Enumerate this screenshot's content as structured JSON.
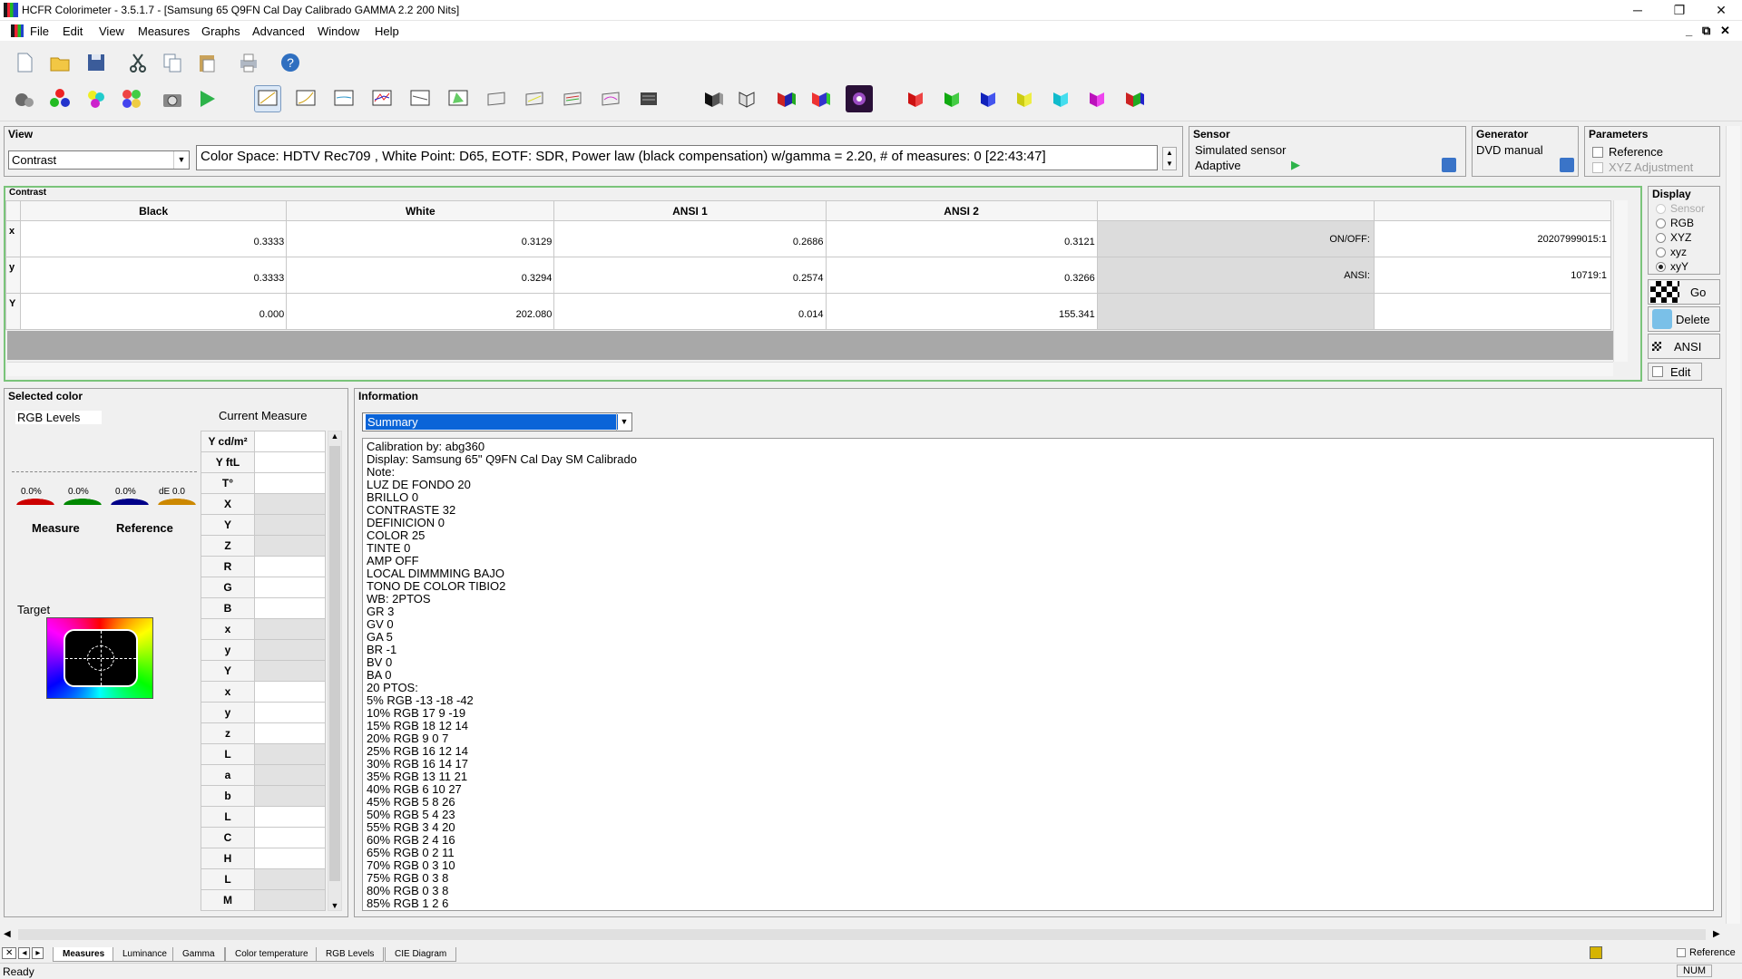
{
  "window": {
    "title": "HCFR Colorimeter - 3.5.1.7 - [Samsung 65 Q9FN Cal Day Calibrado GAMMA 2.2 200 Nits]"
  },
  "menu": [
    "File",
    "Edit",
    "View",
    "Measures",
    "Graphs",
    "Advanced",
    "Window",
    "Help"
  ],
  "view": {
    "header": "View",
    "selected": "Contrast",
    "info": "Color Space: HDTV Rec709 , White Point: D65, EOTF:  SDR, Power law (black compensation) w/gamma = 2.20, # of measures: 0 [22:43:47]"
  },
  "sensor": {
    "header": "Sensor",
    "name": "Simulated sensor",
    "mode": "Adaptive"
  },
  "generator": {
    "header": "Generator",
    "name": "DVD manual"
  },
  "parameters": {
    "header": "Parameters",
    "reference": "Reference",
    "xyz_adjustment": "XYZ Adjustment"
  },
  "contrast": {
    "title": "Contrast",
    "columns": [
      "Black",
      "White",
      "ANSI 1",
      "ANSI 2",
      "",
      ""
    ],
    "rows": [
      {
        "label": "x",
        "values": [
          "0.3333",
          "0.3129",
          "0.2686",
          "0.3121"
        ],
        "metric_label": "ON/OFF:",
        "metric_value": "20207999015:1"
      },
      {
        "label": "y",
        "values": [
          "0.3333",
          "0.3294",
          "0.2574",
          "0.3266"
        ],
        "metric_label": "ANSI:",
        "metric_value": "10719:1"
      },
      {
        "label": "Y",
        "values": [
          "0.000",
          "202.080",
          "0.014",
          "155.341"
        ],
        "metric_label": "",
        "metric_value": ""
      }
    ]
  },
  "display": {
    "header": "Display",
    "options": [
      "Sensor",
      "RGB",
      "XYZ",
      "xyz",
      "xyY"
    ],
    "selected": "xyY"
  },
  "side_buttons": {
    "go": "Go",
    "delete": "Delete",
    "ansi": "ANSI",
    "edit": "Edit"
  },
  "selected_color": {
    "header": "Selected color",
    "rgb_levels": "RGB Levels",
    "current_measure": "Current Measure",
    "bars": [
      "0.0%",
      "0.0%",
      "0.0%",
      "dE 0.0"
    ],
    "measure": "Measure",
    "reference": "Reference",
    "target": "Target",
    "row_labels": [
      "Y cd/m²",
      "Y ftL",
      "T°",
      "X",
      "Y",
      "Z",
      "R",
      "G",
      "B",
      "x",
      "y",
      "Y",
      "x",
      "y",
      "z",
      "L",
      "a",
      "b",
      "L",
      "C",
      "H",
      "L",
      "M"
    ]
  },
  "information": {
    "header": "Information",
    "selected": "Summary",
    "lines": [
      "Calibration by: abg360",
      "Display: Samsung 65\" Q9FN Cal Day SM Calibrado",
      "Note:",
      "LUZ DE FONDO 20",
      "BRILLO 0",
      "CONTRASTE 32",
      "DEFINICION 0",
      "COLOR 25",
      "TINTE 0",
      "AMP OFF",
      "LOCAL DIMMMING BAJO",
      "TONO DE COLOR TIBIO2",
      "WB: 2PTOS",
      "GR 3",
      "GV 0",
      "GA 5",
      "BR -1",
      "BV 0",
      "BA 0",
      "20 PTOS:",
      "5% RGB -13 -18 -42",
      "10% RGB 17 9 -19",
      "15% RGB 18 12 14",
      "20% RGB 9 0 7",
      "25% RGB 16 12 14",
      "30% RGB 16 14 17",
      "35% RGB 13 11 21",
      "40% RGB 6 10 27",
      "45% RGB 5 8 26",
      "50% RGB 5 4 23",
      "55% RGB 3 4 20",
      "60% RGB 2 4 16",
      "65% RGB 0 2 11",
      "70% RGB 0 3 10",
      "75% RGB 0 3 8",
      "80% RGB 0 3 8",
      "85% RGB 1 2 6"
    ]
  },
  "tabs": [
    "Measures",
    "Luminance",
    "Gamma",
    "Color temperature",
    "RGB Levels",
    "CIE Diagram"
  ],
  "active_tab": "Measures",
  "bottom_reference": "Reference",
  "status": {
    "text": "Ready",
    "num": "NUM"
  }
}
